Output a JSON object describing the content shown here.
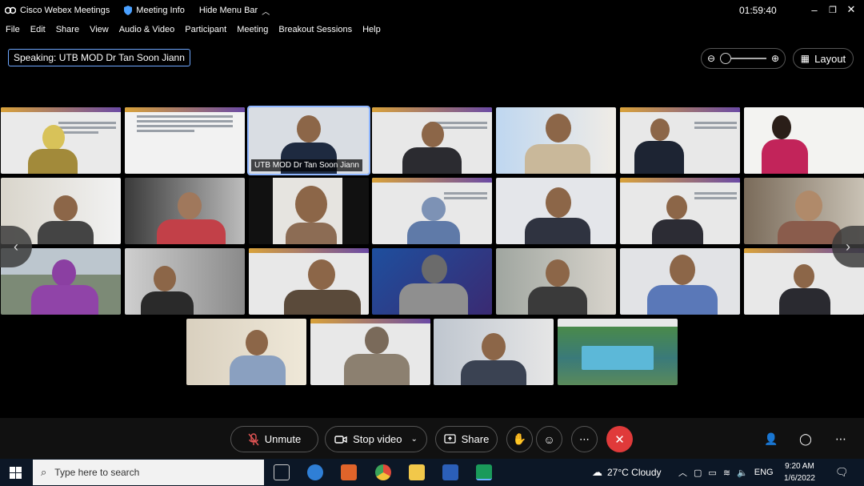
{
  "titlebar": {
    "app_name": "Cisco Webex Meetings",
    "meeting_info": "Meeting Info",
    "hide_menu": "Hide Menu Bar",
    "clock": "01:59:40"
  },
  "menu": [
    "File",
    "Edit",
    "Share",
    "View",
    "Audio & Video",
    "Participant",
    "Meeting",
    "Breakout Sessions",
    "Help"
  ],
  "speaking": {
    "label": "Speaking:",
    "name": "UTB MOD Dr Tan Soon Jiann"
  },
  "layout_label": "Layout",
  "active_tile_name": "UTB MOD Dr Tan Soon Jiann",
  "controls": {
    "unmute": "Unmute",
    "stop_video": "Stop video",
    "share": "Share"
  },
  "taskbar": {
    "search_placeholder": "Type here to search",
    "weather": "27°C  Cloudy",
    "lang": "ENG",
    "time": "9:20 AM",
    "date": "1/6/2022"
  },
  "colors": {
    "accent": "#8fb6ff",
    "end_call": "#e03a3a",
    "slide_band_start": "#d9a23a",
    "slide_band_end": "#6b4aa5"
  }
}
